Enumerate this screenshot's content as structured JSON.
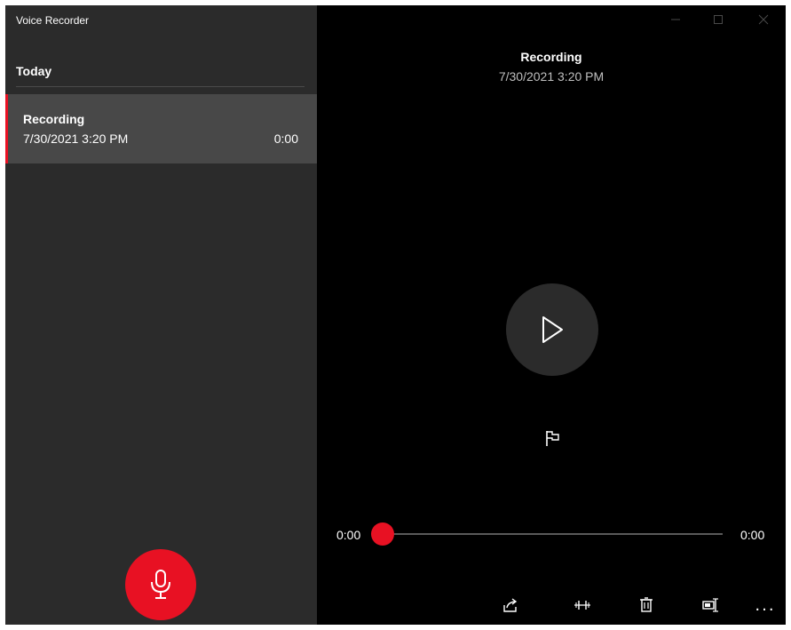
{
  "window": {
    "title": "Voice Recorder",
    "accent_color": "#e81123"
  },
  "sidebar": {
    "group_header": "Today",
    "items": [
      {
        "title": "Recording",
        "date": "7/30/2021 3:20 PM",
        "duration": "0:00",
        "selected": true
      }
    ],
    "record_button_icon": "microphone-icon"
  },
  "now_playing": {
    "title": "Recording",
    "date": "7/30/2021 3:20 PM",
    "play_icon": "play-icon",
    "flag_icon": "flag-icon"
  },
  "playback": {
    "current_time": "0:00",
    "total_time": "0:00",
    "progress": 0
  },
  "command_bar": {
    "icons": [
      "share-icon",
      "trim-icon",
      "delete-icon",
      "rename-icon",
      "more-icon"
    ],
    "more_label": "..."
  },
  "caption_buttons": [
    "minimize-icon",
    "maximize-icon",
    "close-icon"
  ]
}
